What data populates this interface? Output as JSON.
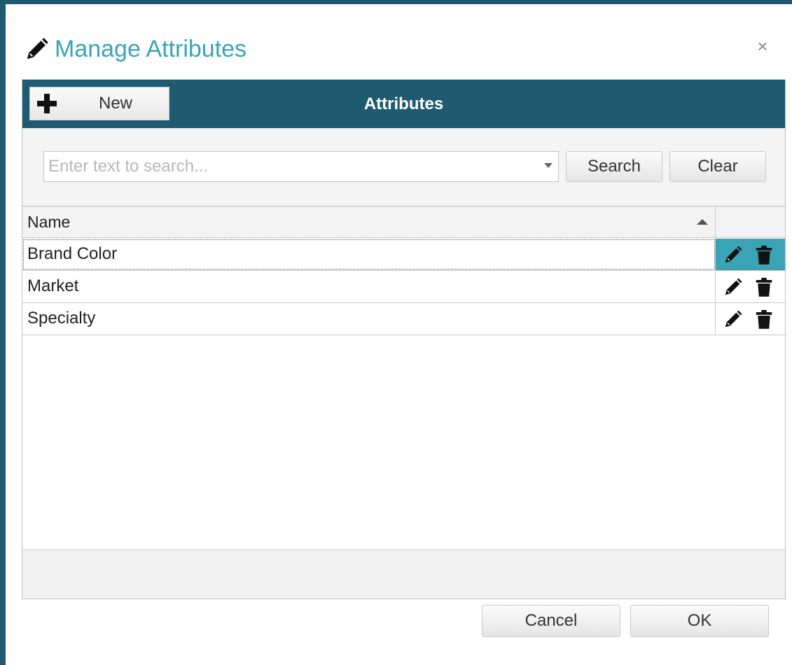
{
  "dialog": {
    "title": "Manage Attributes",
    "title_icon": "pencil-icon",
    "close_label": "×"
  },
  "panel": {
    "header_title": "Attributes",
    "new_button": {
      "label": "New",
      "icon": "plus-icon"
    }
  },
  "search": {
    "placeholder": "Enter text to search...",
    "value": "",
    "search_label": "Search",
    "clear_label": "Clear"
  },
  "grid": {
    "columns": [
      {
        "label": "Name",
        "sort": "ascending"
      },
      {
        "label": ""
      }
    ],
    "rows": [
      {
        "name": "Brand Color",
        "selected": true
      },
      {
        "name": "Market",
        "selected": false
      },
      {
        "name": "Specialty",
        "selected": false
      }
    ],
    "row_actions": [
      "edit-pencil-icon",
      "delete-trash-icon"
    ]
  },
  "footer": {
    "cancel_label": "Cancel",
    "ok_label": "OK"
  },
  "colors": {
    "header_bg": "#1e5a70",
    "accent": "#3aa4b7",
    "selected_row_actions": "#3aa4b7"
  }
}
